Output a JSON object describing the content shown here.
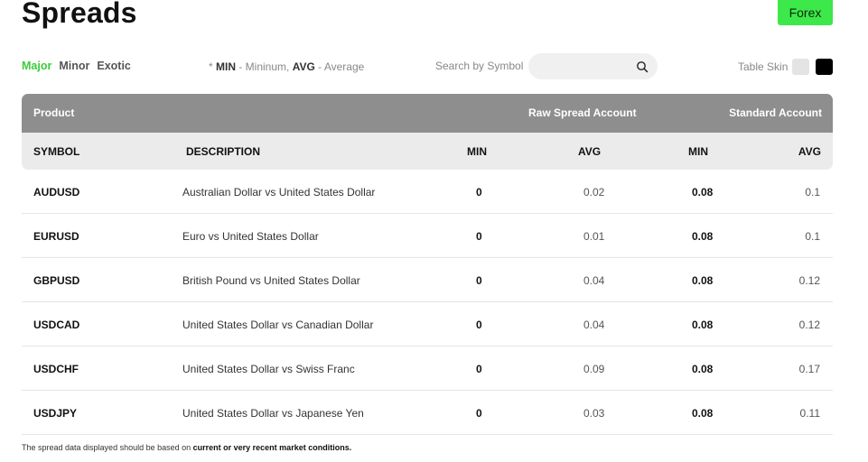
{
  "page": {
    "title": "Spreads"
  },
  "top_button": {
    "label": "Forex"
  },
  "filters": [
    {
      "label": "Major",
      "active": true
    },
    {
      "label": "Minor",
      "active": false
    },
    {
      "label": "Exotic",
      "active": false
    }
  ],
  "legend": {
    "prefix": "* ",
    "min_key": "MIN",
    "min_text": " - Mininum, ",
    "avg_key": "AVG",
    "avg_text": " - Average"
  },
  "search": {
    "label": "Search by Symbol",
    "placeholder": "",
    "value": ""
  },
  "skin": {
    "label": "Table Skin",
    "light_color": "#e4e4e4",
    "dark_color": "#000000"
  },
  "table": {
    "group_headers": {
      "product": "Product",
      "raw": "Raw Spread Account",
      "standard": "Standard Account"
    },
    "columns": {
      "symbol": "SYMBOL",
      "description": "DESCRIPTION",
      "raw_min": "MIN",
      "raw_avg": "AVG",
      "std_min": "MIN",
      "std_avg": "AVG"
    },
    "rows": [
      {
        "symbol": "AUDUSD",
        "description": "Australian Dollar vs United States Dollar",
        "raw_min": "0",
        "raw_avg": "0.02",
        "std_min": "0.08",
        "std_avg": "0.1"
      },
      {
        "symbol": "EURUSD",
        "description": "Euro vs United States Dollar",
        "raw_min": "0",
        "raw_avg": "0.01",
        "std_min": "0.08",
        "std_avg": "0.1"
      },
      {
        "symbol": "GBPUSD",
        "description": "British Pound vs United States Dollar",
        "raw_min": "0",
        "raw_avg": "0.04",
        "std_min": "0.08",
        "std_avg": "0.12"
      },
      {
        "symbol": "USDCAD",
        "description": "United States Dollar vs Canadian Dollar",
        "raw_min": "0",
        "raw_avg": "0.04",
        "std_min": "0.08",
        "std_avg": "0.12"
      },
      {
        "symbol": "USDCHF",
        "description": "United States Dollar vs Swiss Franc",
        "raw_min": "0",
        "raw_avg": "0.09",
        "std_min": "0.08",
        "std_avg": "0.17"
      },
      {
        "symbol": "USDJPY",
        "description": "United States Dollar vs Japanese Yen",
        "raw_min": "0",
        "raw_avg": "0.03",
        "std_min": "0.08",
        "std_avg": "0.11"
      }
    ]
  },
  "footnote": {
    "text": "The spread data displayed should be based on ",
    "bold": "current or very recent market conditions."
  },
  "colors": {
    "accent": "#3de84a",
    "active_filter": "#3dcc3d",
    "group_header_bg": "#8e8e8e",
    "col_header_bg": "#ebebeb"
  }
}
